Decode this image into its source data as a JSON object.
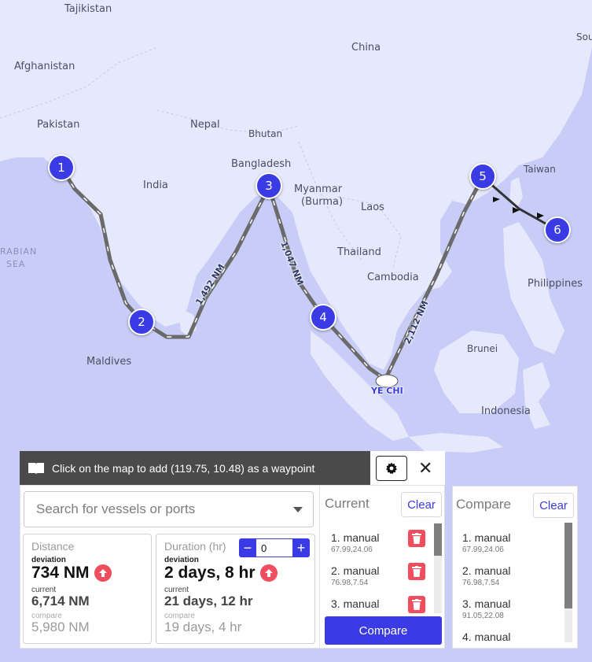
{
  "map": {
    "labels": {
      "tajikistan": "Tajikistan",
      "afghanistan": "Afghanistan",
      "pakistan": "Pakistan",
      "china": "China",
      "nepal": "Nepal",
      "bhutan": "Bhutan",
      "bangladesh": "Bangladesh",
      "india": "India",
      "myanmar": "Myanmar",
      "burma": "(Burma)",
      "laos": "Laos",
      "taiwan": "Taiwan",
      "arabian": "RABIAN",
      "sea": "SEA",
      "thailand": "Thailand",
      "cambodia": "Cambodia",
      "philippines": "Philippines",
      "maldives": "Maldives",
      "brunei": "Brunei",
      "indonesia": "Indonesia",
      "sou": "Sou"
    },
    "waypoints": [
      "1",
      "2",
      "3",
      "4",
      "5",
      "6"
    ],
    "route_labels": {
      "leg2_3": "1,492 NM",
      "leg3_4": "1,047 NM",
      "leg4_5": "2,112 NM",
      "port": "YE CHI"
    }
  },
  "hint": {
    "text": "Click on the map to add (119.75, 10.48) as a waypoint",
    "icon": "book-icon"
  },
  "toolbar": {
    "settings_icon": "gear-icon",
    "close": "✕"
  },
  "search": {
    "placeholder": "Search for vessels or ports"
  },
  "distance": {
    "title": "Distance",
    "deviation_label": "deviation",
    "deviation_value": "734 NM",
    "current_label": "current",
    "current_value": "6,714 NM",
    "compare_label": "compare",
    "compare_value": "5,980 NM"
  },
  "duration": {
    "title": "Duration (hr)",
    "stepper_value": "0",
    "minus": "−",
    "plus": "+",
    "deviation_label": "deviation",
    "deviation_value": "2 days, 8 hr",
    "current_label": "current",
    "current_value": "21 days, 12 hr",
    "compare_label": "compare",
    "compare_value": "19 days, 4 hr"
  },
  "current": {
    "title": "Current",
    "clear": "Clear",
    "items": [
      {
        "name": "1. manual",
        "coord": "67.99,24.06"
      },
      {
        "name": "2. manual",
        "coord": "76.98,7.54"
      },
      {
        "name": "3. manual",
        "coord": ""
      }
    ],
    "compare_button": "Compare",
    "scroll_fraction": 0.33
  },
  "compare": {
    "title": "Compare",
    "clear": "Clear",
    "items": [
      {
        "name": "1. manual",
        "coord": "67.99,24.06"
      },
      {
        "name": "2. manual",
        "coord": "76.98,7.54"
      },
      {
        "name": "3. manual",
        "coord": "91.05,22.08"
      },
      {
        "name": "4. manual",
        "coord": ""
      }
    ],
    "scroll_fraction": 0.75
  },
  "colors": {
    "accent": "#3b3be6",
    "danger": "#f04e5e",
    "map_sea": "#c8cdf7",
    "map_land": "#e6e8fb",
    "hint_bg": "#4a4a4a"
  }
}
